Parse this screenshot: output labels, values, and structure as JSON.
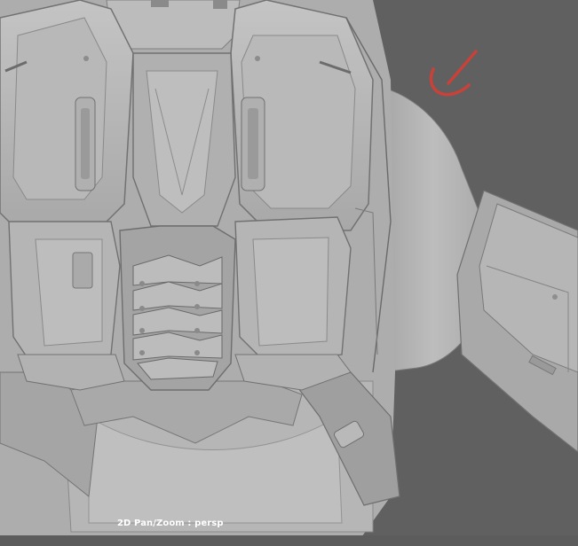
{
  "viewport": {
    "background_color": "#606060",
    "model_color": "#b4b4b4",
    "annotation_color": "#c8423a",
    "hud_label": "2D Pan/Zoom : persp"
  },
  "icons": {
    "annotation": "red-stroke-arrow-icon"
  }
}
